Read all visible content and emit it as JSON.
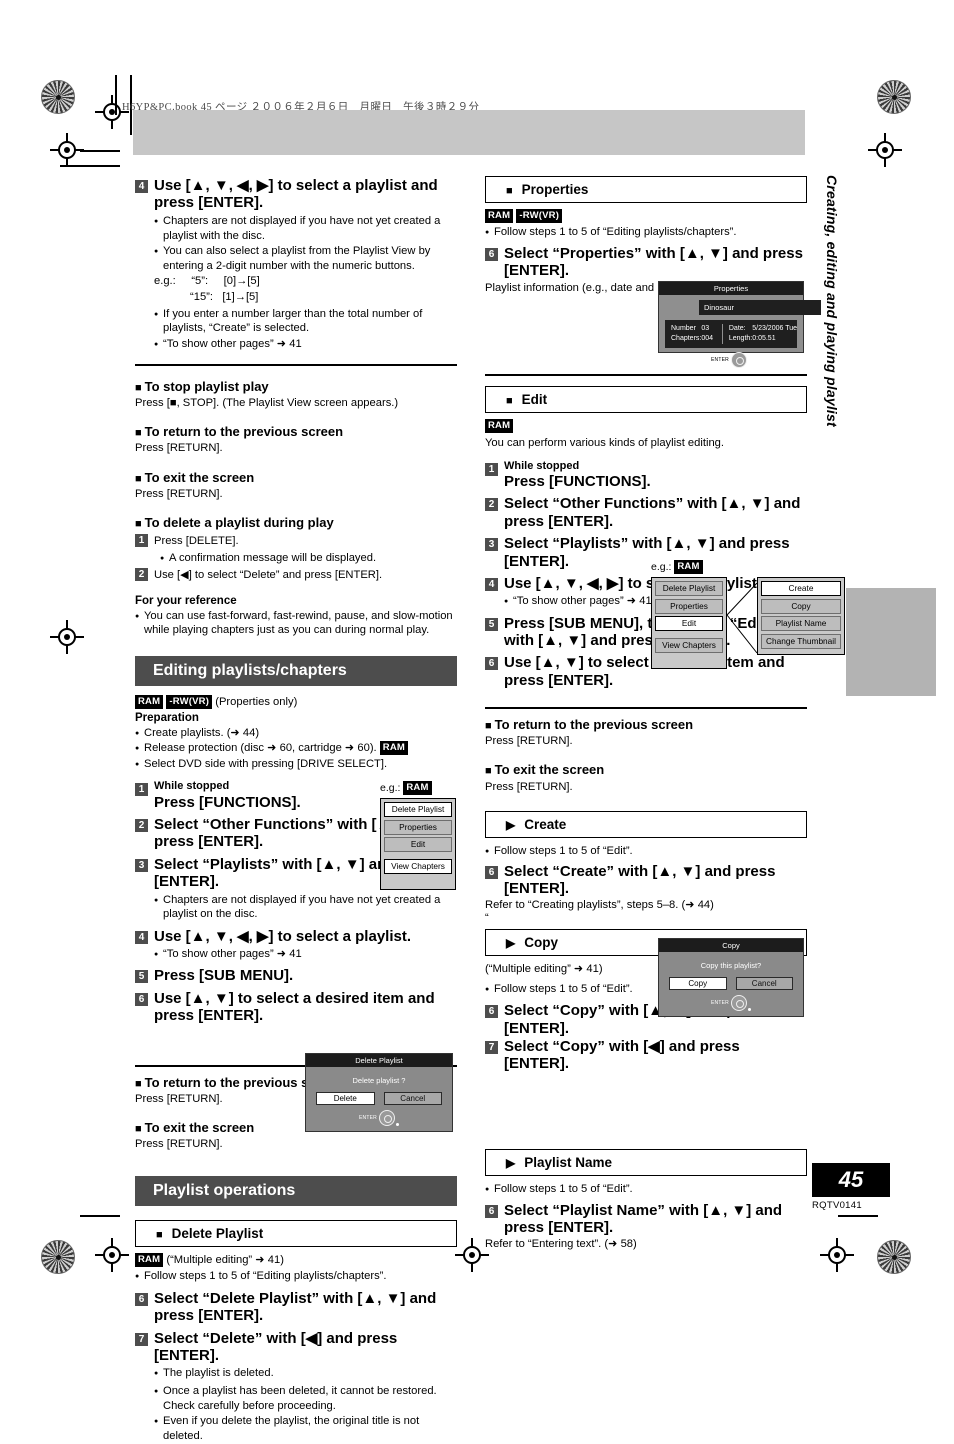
{
  "page": {
    "running_head": "H6YP&PC.book  45 ページ  ２００６年２月６日　月曜日　午後３時２９分",
    "vertical_title": "Creating, editing and playing playlist",
    "page_number": "45",
    "part_number": "RQTV0141"
  },
  "left_column": {
    "step4": {
      "num": "4",
      "title": "Use [▲, ▼, ◀, ▶] to select a playlist and press [ENTER].",
      "bullets": [
        "Chapters are not displayed if you have not yet created a playlist with the disc.",
        "You can also select a playlist from the Playlist View by entering a 2-digit number with the numeric buttons."
      ],
      "eg_label": "e.g.:",
      "eg_line1": "“5”:     [0]→[5]",
      "eg_line2": "“15”:   [1]→[5]",
      "bullets_after": [
        "If you enter a number larger than the total number of playlists, “Create” is selected.",
        "“To show other pages” ➜ 41"
      ]
    },
    "stop_play": {
      "head": "To stop playlist play",
      "body": "Press [■, STOP]. (The Playlist View screen appears.)"
    },
    "return_prev": {
      "head": "To return to the previous screen",
      "body": "Press [RETURN]."
    },
    "exit_screen": {
      "head": "To exit the screen",
      "body": "Press [RETURN]."
    },
    "delete_during_play": {
      "head": "To delete a playlist during play",
      "step1_num": "1",
      "step1": "Press [DELETE].",
      "step1_bullet": "A confirmation message will be displayed.",
      "step2_num": "2",
      "step2": "Use [◀] to select “Delete” and press [ENTER]."
    },
    "reference": {
      "head": "For your reference",
      "bullet": "You can use fast-forward, fast-rewind, pause, and slow-motion while playing chapters just as you can during normal play."
    },
    "editing_section": {
      "banner": "Editing playlists/chapters",
      "badge_ram": "RAM",
      "badge_rwvr": "-RW(VR)",
      "badge_note": "(Properties only)",
      "prep_head": "Preparation",
      "prep_bullets": [
        "Create playlists. (➜ 44)",
        "Release protection (disc ➜ 60, cartridge ➜ 60).",
        "Select DVD side with pressing [DRIVE SELECT]."
      ],
      "prep_badge": "RAM",
      "steps": [
        {
          "num": "1",
          "lead": "While stopped",
          "text": "Press [FUNCTIONS]."
        },
        {
          "num": "2",
          "text": "Select “Other Functions” with [▲, ▼] and press [ENTER]."
        },
        {
          "num": "3",
          "text": "Select “Playlists” with [▲, ▼] and press [ENTER]."
        },
        {
          "num": "4",
          "text": "Use [▲, ▼, ◀, ▶] to select a playlist."
        },
        {
          "num": "5",
          "text": "Press [SUB MENU]."
        },
        {
          "num": "6",
          "text": "Use [▲, ▼] to select a desired item and press [ENTER]."
        }
      ],
      "step3_bullet": "Chapters are not displayed if you have not yet created a playlist on the disc.",
      "step4_bullet": "“To show other pages” ➜ 41",
      "menu": {
        "eg_label": "e.g.:",
        "eg_badge": "RAM",
        "items": [
          {
            "label": "Delete Playlist",
            "selected": true
          },
          {
            "label": "Properties",
            "selected": false
          },
          {
            "label": "Edit",
            "selected": false
          },
          {
            "label": "View Chapters",
            "selected": false
          }
        ]
      },
      "return_prev": {
        "head": "To return to the previous screen",
        "body": "Press [RETURN]."
      },
      "exit_screen": {
        "head": "To exit the screen",
        "body": "Press [RETURN]."
      }
    },
    "playlist_ops": {
      "banner": "Playlist operations",
      "delete_playlist": {
        "boxhead": "Delete Playlist",
        "badge": "RAM",
        "badge_note": "(“Multiple editing” ➜ 41)",
        "follow": "Follow steps 1 to 5 of “Editing playlists/chapters”.",
        "step6_num": "6",
        "step6": "Select “Delete Playlist” with [▲, ▼] and press [ENTER].",
        "step7_num": "7",
        "step7": "Select “Delete” with [◀] and press [ENTER].",
        "bullets": [
          "The playlist is deleted.",
          "Once a playlist has been deleted, it cannot be restored. Check carefully before proceeding.",
          "Even if you delete the playlist, the original title is not deleted."
        ],
        "dialog": {
          "title": "Delete Playlist",
          "question": "Delete playlist ?",
          "btn_ok": "Delete",
          "btn_cancel": "Cancel",
          "enter_label": "ENTER"
        }
      }
    }
  },
  "right_column": {
    "properties": {
      "boxhead": "Properties",
      "badge_ram": "RAM",
      "badge_rwvr": "-RW(VR)",
      "follow": "Follow steps 1 to 5 of “Editing playlists/chapters”.",
      "step6_num": "6",
      "step6": "Select “Properties” with [▲, ▼] and press [ENTER].",
      "note": "Playlist information (e.g., date and length) is shown.",
      "dialog": {
        "title": "Properties",
        "name": "Dinosaur",
        "k_number": "Number",
        "v_number": "03",
        "k_chapters": "Chapters:",
        "v_chapters": "004",
        "k_date": "Date:",
        "v_date": "5/23/2006 Tue",
        "k_length": "Length:",
        "v_length": "0:05.51",
        "enter_label": "ENTER"
      }
    },
    "edit": {
      "boxhead": "Edit",
      "badge": "RAM",
      "intro": "You can perform various kinds of playlist editing.",
      "steps": [
        {
          "num": "1",
          "lead": "While stopped",
          "text": "Press [FUNCTIONS]."
        },
        {
          "num": "2",
          "text": "Select “Other Functions” with [▲, ▼] and press [ENTER]."
        },
        {
          "num": "3",
          "text": "Select “Playlists” with [▲, ▼] and press [ENTER]."
        },
        {
          "num": "4",
          "text": "Use [▲, ▼, ◀, ▶] to select a playlist."
        },
        {
          "num": "5",
          "text": "Press [SUB MENU], then select “Edit” with [▲, ▼] and press [ENTER]."
        },
        {
          "num": "6",
          "text": "Use [▲, ▼] to select a desired item and press [ENTER]."
        }
      ],
      "step4_bullet": "“To show other pages” ➜ 41",
      "menu": {
        "eg_label": "e.g.:",
        "eg_badge": "RAM",
        "primary": [
          {
            "label": "Delete Playlist",
            "selected": false
          },
          {
            "label": "Properties",
            "selected": false
          },
          {
            "label": "Edit",
            "selected": true
          },
          {
            "label": "View Chapters",
            "selected": false
          }
        ],
        "secondary": [
          {
            "label": "Create",
            "selected": true
          },
          {
            "label": "Copy",
            "selected": false
          },
          {
            "label": "Playlist Name",
            "selected": false
          },
          {
            "label": "Change Thumbnail",
            "selected": false
          }
        ]
      },
      "return_prev": {
        "head": "To return to the previous screen",
        "body": "Press [RETURN]."
      },
      "exit_screen": {
        "head": "To exit the screen",
        "body": "Press [RETURN]."
      }
    },
    "create": {
      "boxhead": "Create",
      "follow": "Follow steps 1 to 5 of “Edit”.",
      "step6_num": "6",
      "step6": "Select “Create” with [▲, ▼] and press [ENTER].",
      "refer": "Refer to “Creating playlists”, steps 5–8. (➜ 44)",
      "stray_quote": "“"
    },
    "copy": {
      "boxhead": "Copy",
      "note": "(“Multiple editing” ➜ 41)",
      "follow": "Follow steps 1 to 5 of “Edit”.",
      "step6_num": "6",
      "step6": "Select “Copy” with [▲, ▼] and press [ENTER].",
      "step7_num": "7",
      "step7": "Select “Copy” with [◀] and press [ENTER].",
      "dialog": {
        "title": "Copy",
        "question": "Copy this playlist?",
        "btn_ok": "Copy",
        "btn_cancel": "Cancel",
        "enter_label": "ENTER"
      }
    },
    "playlist_name": {
      "boxhead": "Playlist Name",
      "follow": "Follow steps 1 to 5 of “Edit”.",
      "step6_num": "6",
      "step6": "Select “Playlist Name” with [▲, ▼] and press [ENTER].",
      "refer": "Refer to “Entering text”. (➜ 58)"
    }
  }
}
